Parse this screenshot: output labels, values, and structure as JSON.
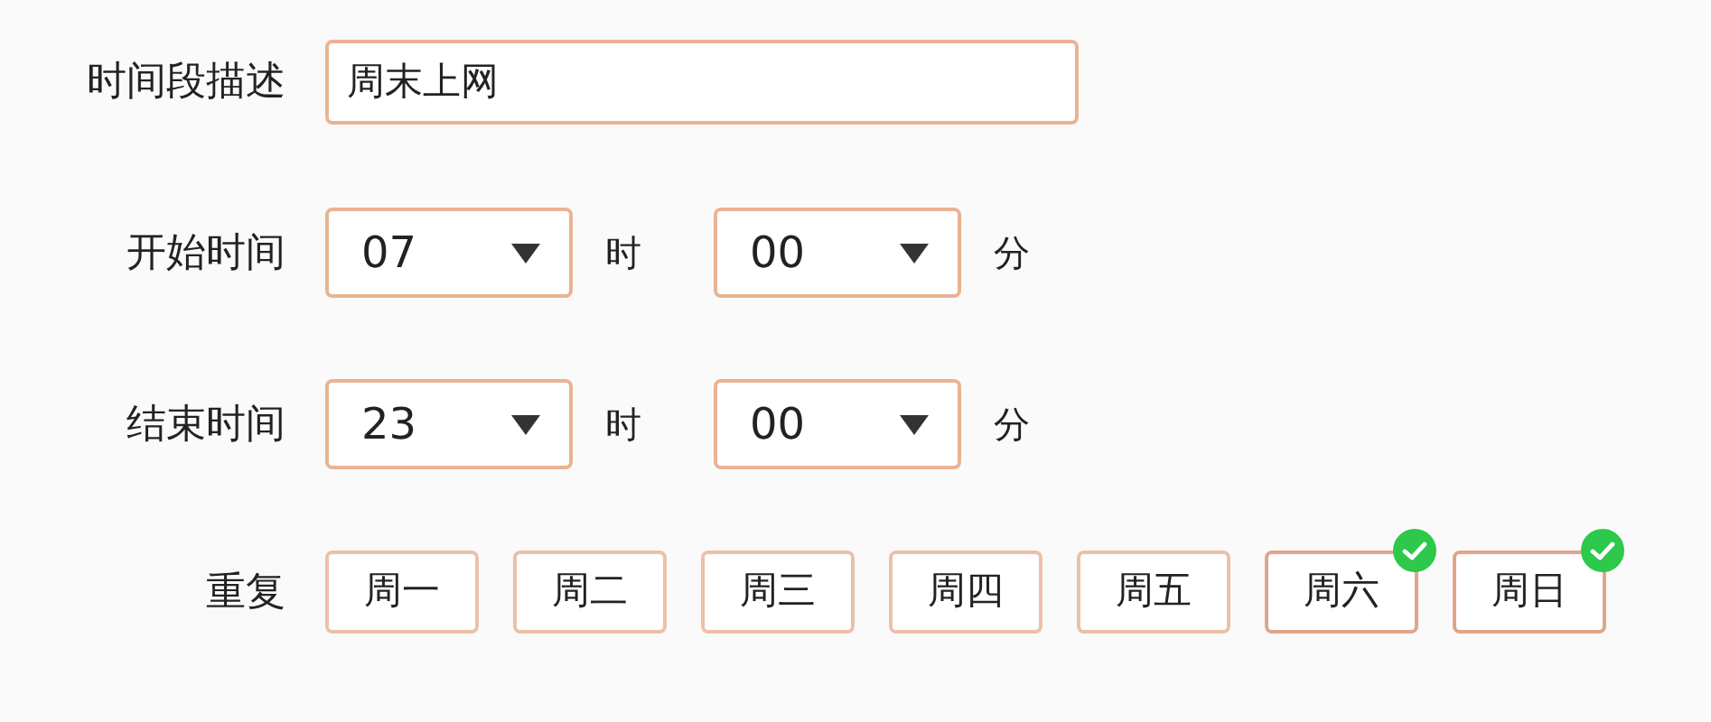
{
  "description": {
    "label": "时间段描述",
    "value": "周末上网"
  },
  "times": [
    {
      "label": "开始时间",
      "hour": "07",
      "hour_unit": "时",
      "minute": "00",
      "minute_unit": "分"
    },
    {
      "label": "结束时间",
      "hour": "23",
      "hour_unit": "时",
      "minute": "00",
      "minute_unit": "分"
    }
  ],
  "repeat": {
    "label": "重复",
    "days": [
      {
        "label": "周一",
        "selected": false
      },
      {
        "label": "周二",
        "selected": false
      },
      {
        "label": "周三",
        "selected": false
      },
      {
        "label": "周四",
        "selected": false
      },
      {
        "label": "周五",
        "selected": false
      },
      {
        "label": "周六",
        "selected": true
      },
      {
        "label": "周日",
        "selected": true
      }
    ]
  }
}
